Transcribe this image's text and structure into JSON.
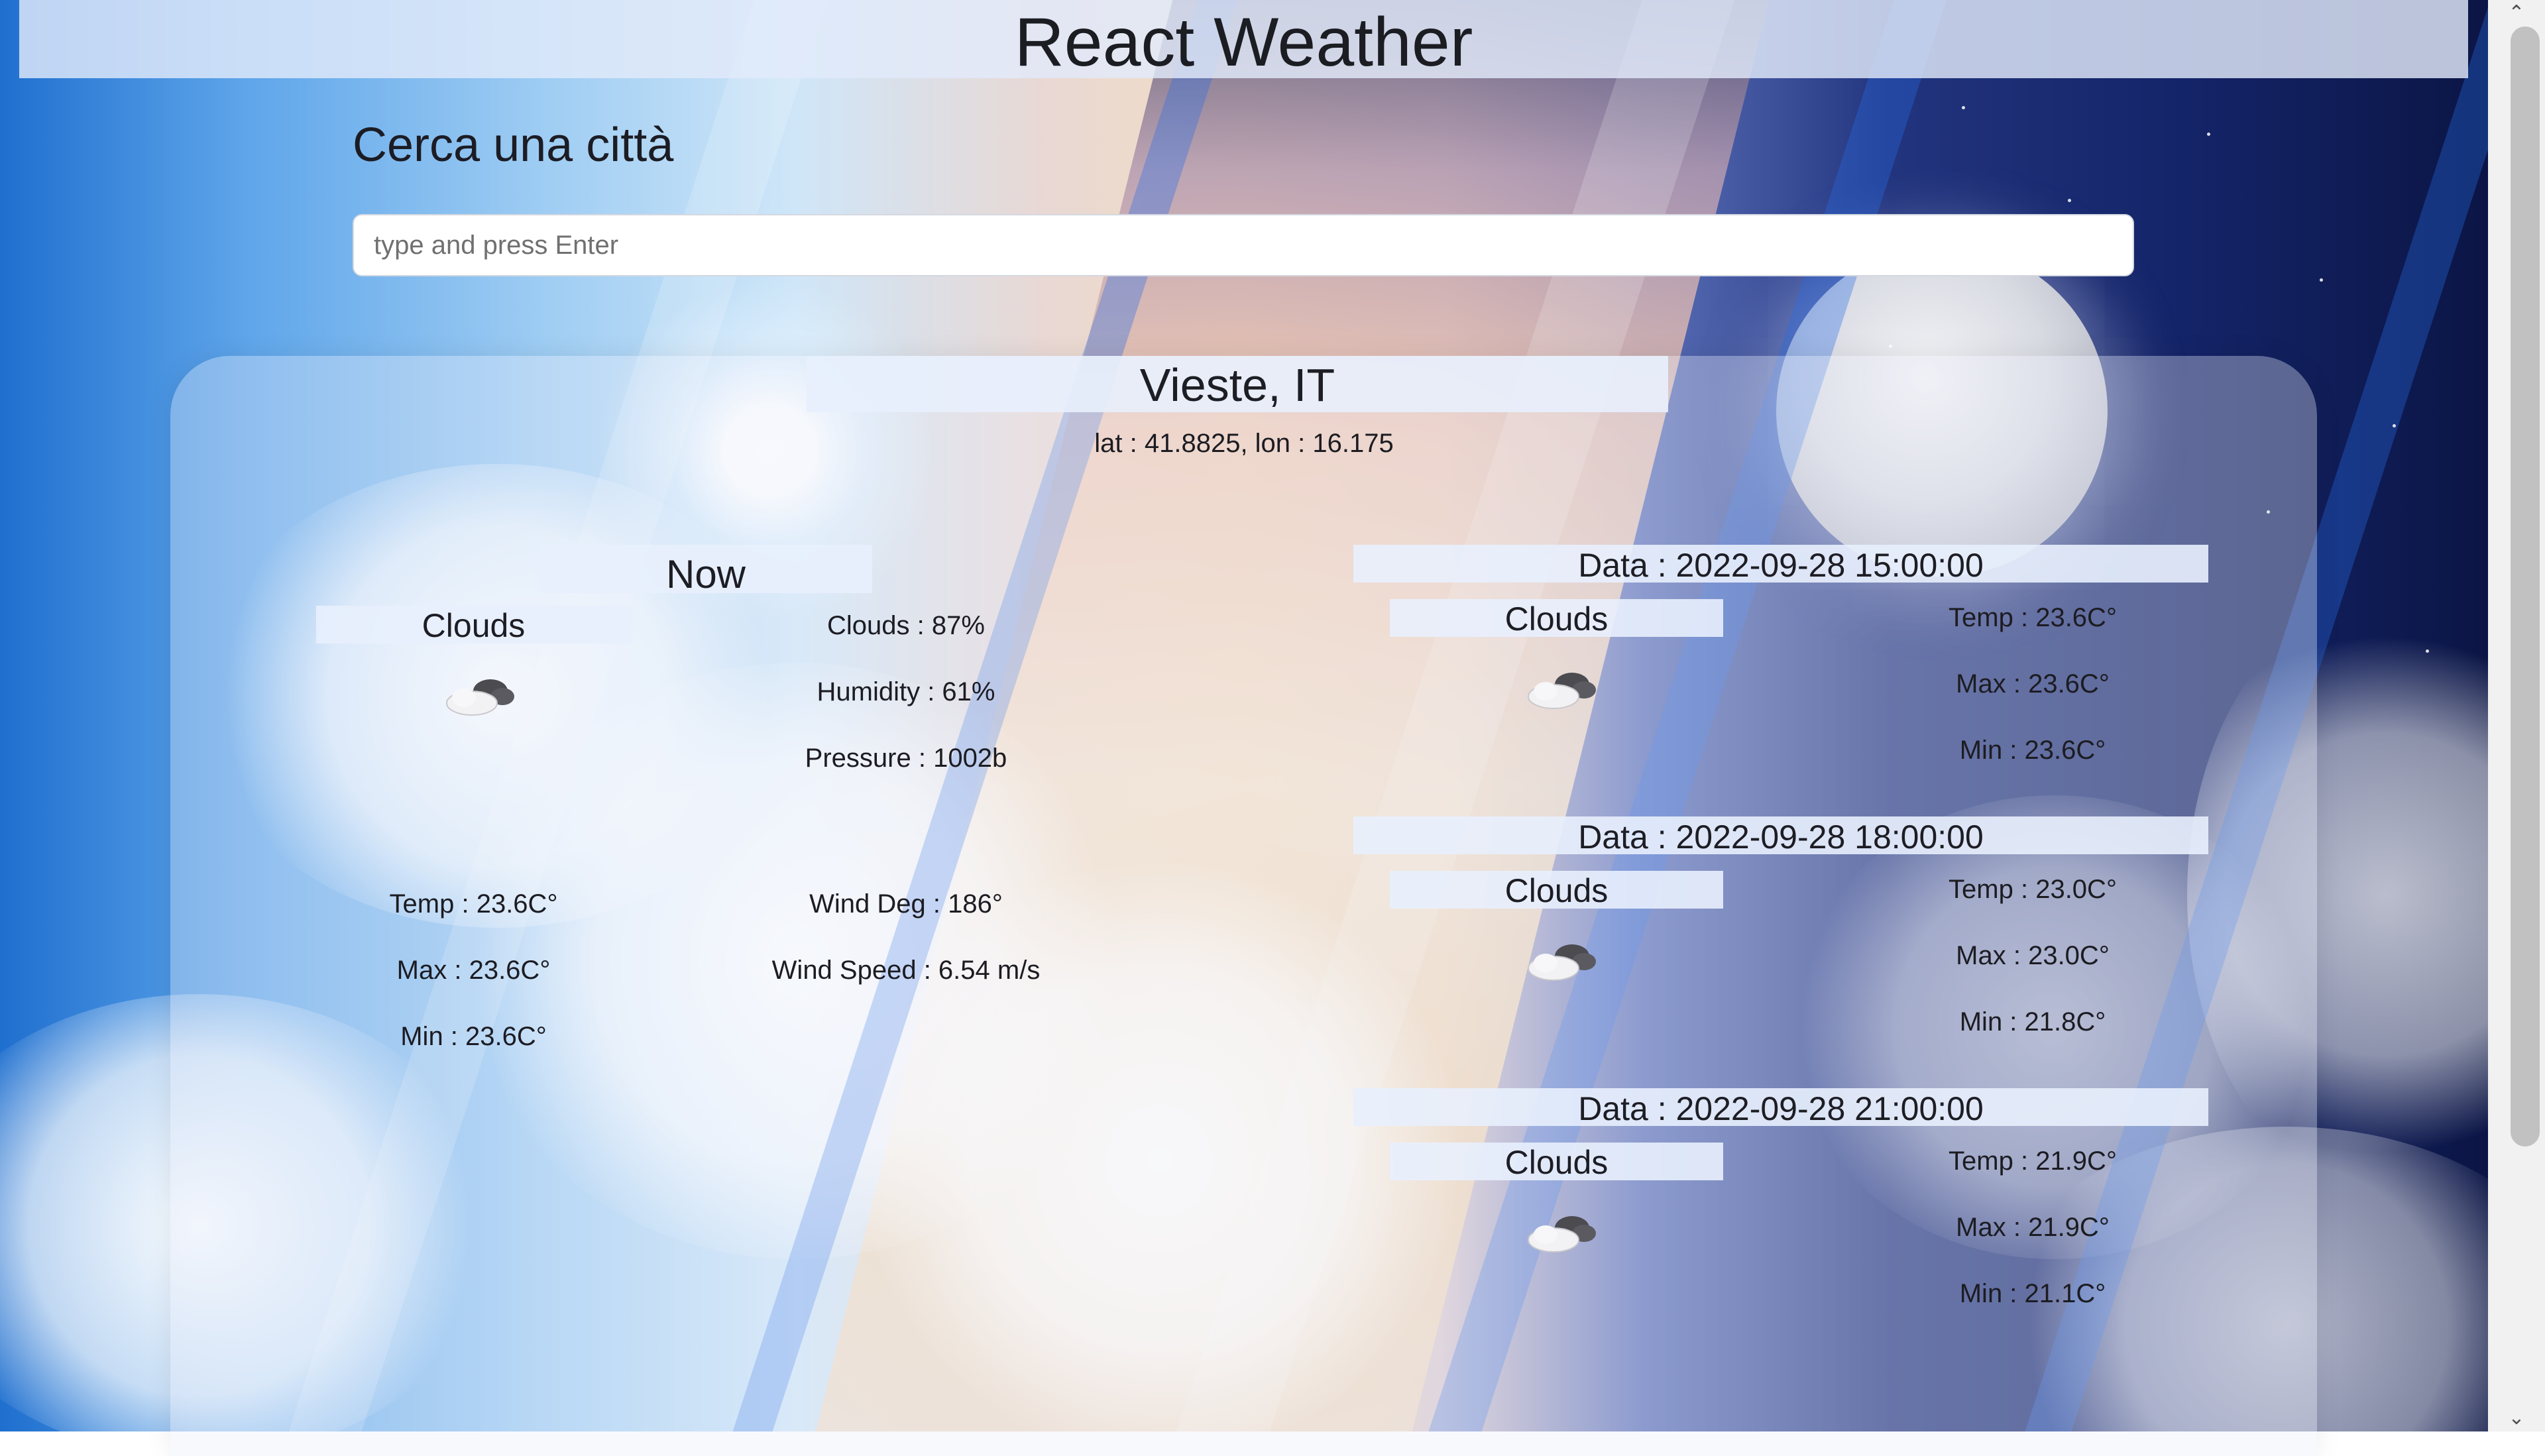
{
  "app": {
    "title": "React Weather"
  },
  "search": {
    "label": "Cerca una città",
    "placeholder": "type and press Enter",
    "value": ""
  },
  "location": {
    "name": "Vieste, IT",
    "coords": "lat : 41.8825, lon : 16.175"
  },
  "current": {
    "heading": "Now",
    "condition": "Clouds",
    "icon": "cloudy-icon",
    "clouds": "Clouds : 87%",
    "humidity": "Humidity : 61%",
    "pressure": "Pressure : 1002b",
    "temp": "Temp : 23.6C°",
    "max": "Max : 23.6C°",
    "min": "Min : 23.6C°",
    "wind_deg": "Wind Deg : 186°",
    "wind_speed": "Wind Speed : 6.54 m/s"
  },
  "forecast": [
    {
      "date": "Data : 2022-09-28 15:00:00",
      "condition": "Clouds",
      "icon": "cloudy-icon",
      "temp": "Temp : 23.6C°",
      "max": "Max : 23.6C°",
      "min": "Min : 23.6C°"
    },
    {
      "date": "Data : 2022-09-28 18:00:00",
      "condition": "Clouds",
      "icon": "cloudy-icon",
      "temp": "Temp : 23.0C°",
      "max": "Max : 23.0C°",
      "min": "Min : 21.8C°"
    },
    {
      "date": "Data : 2022-09-28 21:00:00",
      "condition": "Clouds",
      "icon": "cloudy-icon",
      "temp": "Temp : 21.9C°",
      "max": "Max : 21.9C°",
      "min": "Min : 21.1C°"
    }
  ],
  "colors": {
    "header_bg": "#e2eafa",
    "panel_bg": "#e8f0fd",
    "scrollbar_track": "#f1f1f1",
    "scrollbar_thumb": "#c1c1c1"
  }
}
